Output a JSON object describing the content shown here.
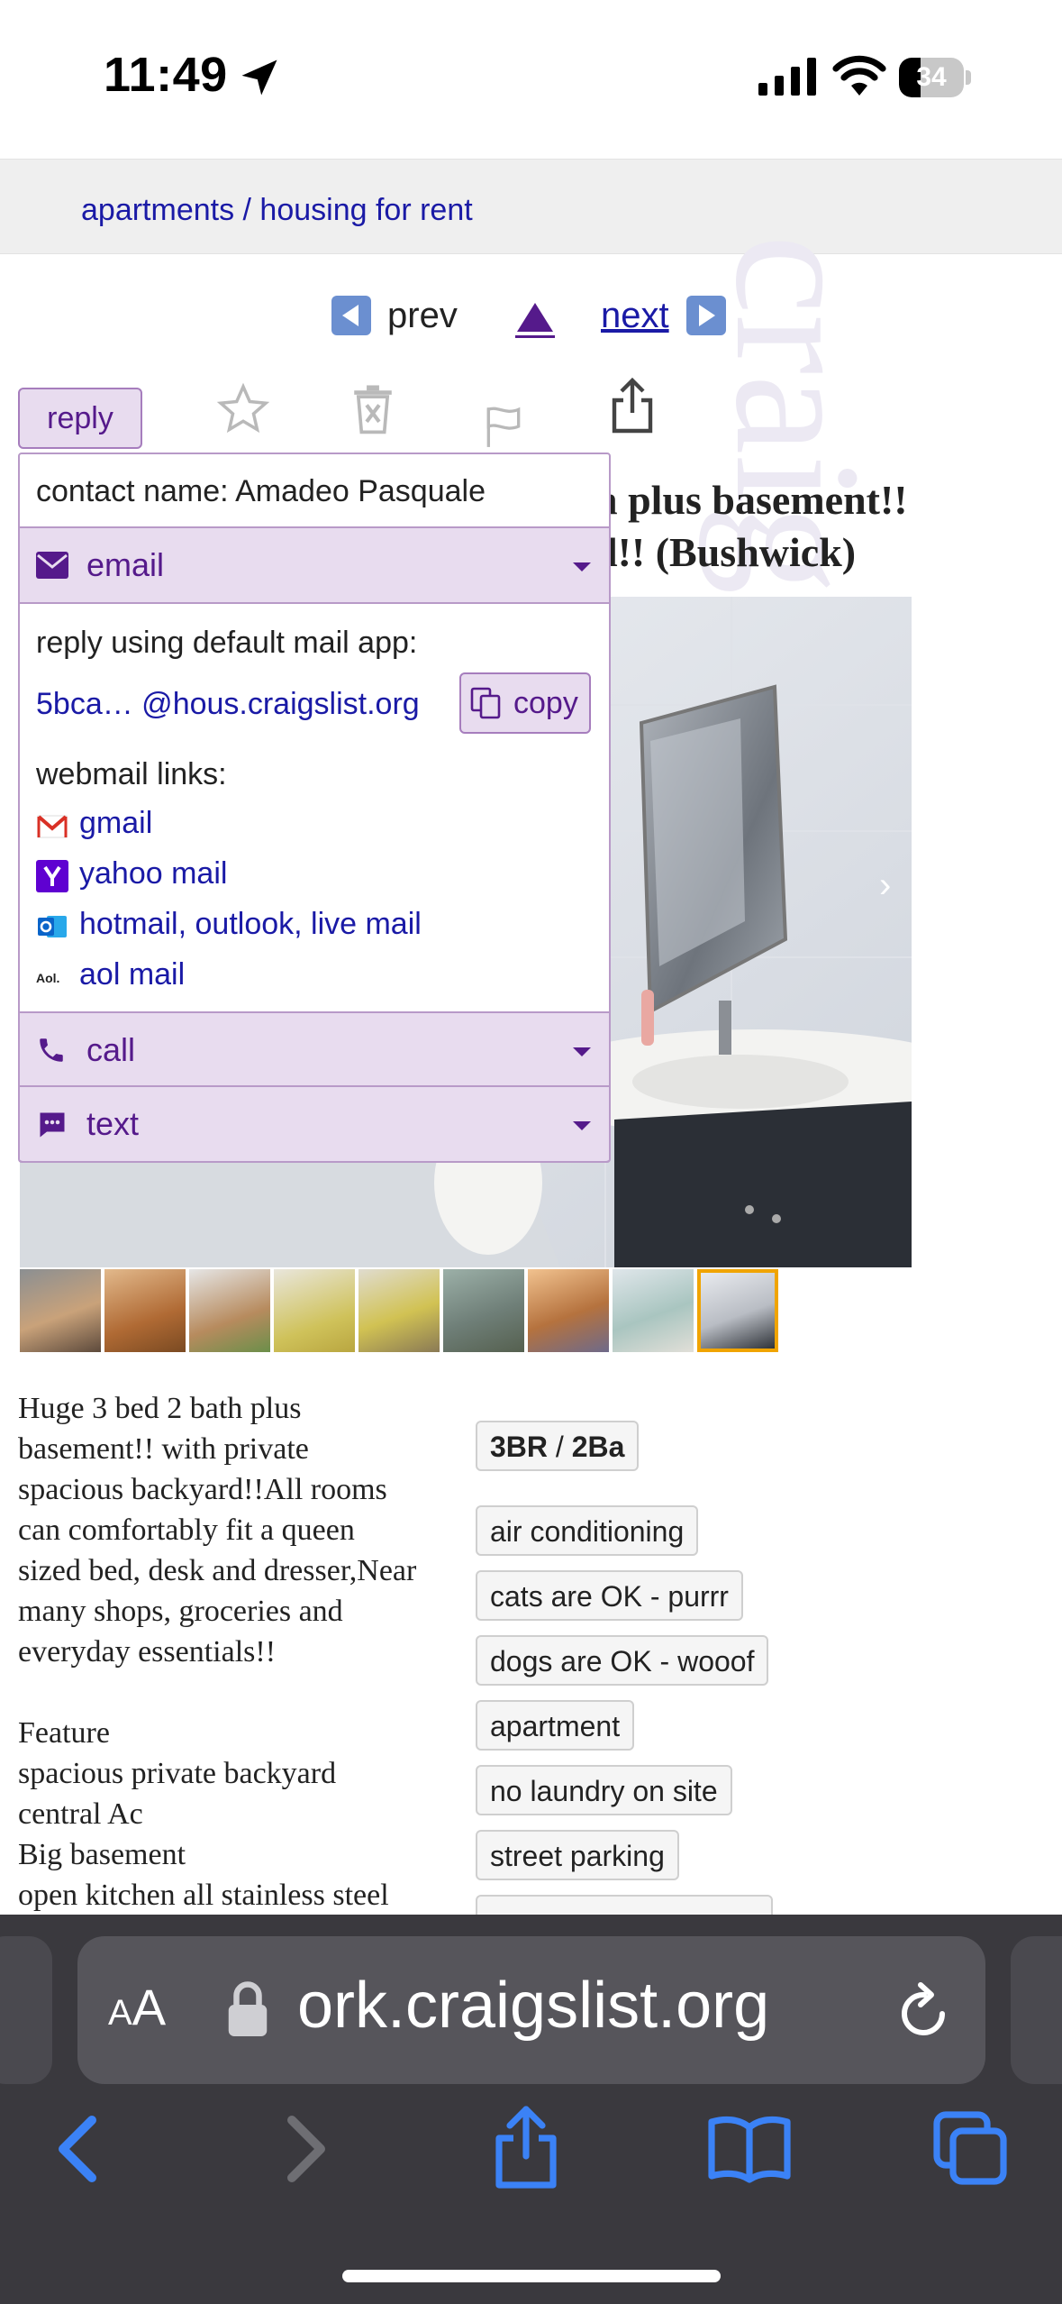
{
  "status_bar": {
    "time": "11:49",
    "battery_percent": 34,
    "battery_label": "34"
  },
  "breadcrumb": "apartments / housing for rent",
  "watermark": "craigslist",
  "nav": {
    "prev_label": "prev",
    "next_label": "next"
  },
  "actions": {
    "reply_label": "reply"
  },
  "listing": {
    "title_line1": "h plus basement!!",
    "title_line2": "d!! (Bushwick)",
    "photo_count": 9,
    "selected_thumbnail": 9,
    "body": "Huge 3 bed 2 bath plus\nbasement!! with private\nspacious backyard!!All rooms\ncan comfortably fit a queen\nsized bed, desk and dresser,Near\nmany shops, groceries and\neveryday essentials!!\n\nFeature\nspacious private backyard\ncentral Ac\nBig basement\nopen kitchen all stainless steel",
    "bedrooms_label": "3BR",
    "baths_label": "2Ba",
    "attributes": [
      "air conditioning",
      "cats are OK - purrr",
      "dogs are OK - wooof",
      "apartment",
      "no laundry on site",
      "street parking"
    ]
  },
  "reply_popup": {
    "contact_name": "contact name: Amadeo Pasquale",
    "email_section": "email",
    "reply_default": "reply using default mail app:",
    "email_address": "5bca… @hous.craigslist.org",
    "copy_label": "copy",
    "webmail_label": "webmail links:",
    "webmail_links": [
      "gmail",
      "yahoo mail",
      "hotmail, outlook, live mail",
      "aol mail"
    ],
    "call_section": "call",
    "text_section": "text"
  },
  "browser": {
    "aa_label_small": "A",
    "aa_label_big": "A",
    "url_display": "ork.craigslist.org"
  },
  "colors": {
    "link": "#1a1aa6",
    "accent_purple": "#551a8b",
    "reply_bg": "#e8dcef",
    "reply_border": "#a67dbd",
    "safari_accent": "#3b82f6",
    "toolbar_bg": "#3a393e"
  },
  "icons": {
    "status": [
      "location-arrow-icon",
      "cellular-signal-icon",
      "wifi-icon",
      "battery-icon"
    ],
    "actions": [
      "star-icon",
      "trash-icon",
      "flag-icon",
      "share-icon"
    ],
    "toolbar": [
      "back-icon",
      "forward-icon",
      "share-icon",
      "bookmarks-icon",
      "tabs-icon"
    ]
  }
}
